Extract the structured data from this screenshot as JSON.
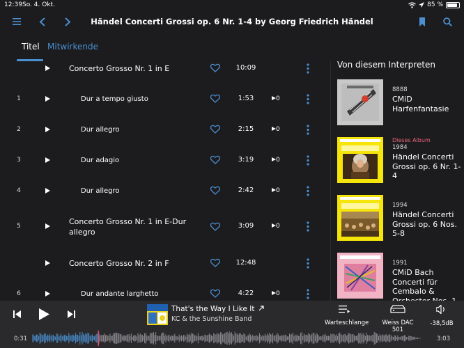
{
  "status": {
    "time": "12:39",
    "date": "So. 4. Okt.",
    "battery": "85 %"
  },
  "nav": {
    "title": "Händel Concerti Grossi op. 6 Nr. 1-4 by Georg Friedrich Händel"
  },
  "tabs": [
    {
      "label": "Titel",
      "active": true
    },
    {
      "label": "Mitwirkende",
      "active": false
    }
  ],
  "tracks": [
    {
      "num": "",
      "name": "Concerto Grosso Nr. 1 in E",
      "duration": "10:09",
      "plays": "",
      "header": true
    },
    {
      "num": "1",
      "name": "Dur a tempo giusto",
      "duration": "1:53",
      "plays": "0",
      "header": false
    },
    {
      "num": "2",
      "name": "Dur allegro",
      "duration": "2:15",
      "plays": "0",
      "header": false
    },
    {
      "num": "3",
      "name": "Dur adagio",
      "duration": "3:19",
      "plays": "0",
      "header": false
    },
    {
      "num": "4",
      "name": "Dur allegro",
      "duration": "2:42",
      "plays": "0",
      "header": false
    },
    {
      "num": "5",
      "name": "Concerto Grosso Nr. 1 in E-Dur",
      "name2": "allegro",
      "duration": "3:09",
      "plays": "0",
      "header": true
    },
    {
      "num": "",
      "name": "Concerto Grosso Nr. 2 in F",
      "duration": "12:48",
      "plays": "",
      "header": true
    },
    {
      "num": "6",
      "name": "Dur andante larghetto",
      "duration": "4:22",
      "plays": "0",
      "header": false
    }
  ],
  "sidebar": {
    "heading": "Von diesem Interpreten",
    "albums": [
      {
        "badge": "",
        "year": "8888",
        "name": "CMiD Harfenfantasie"
      },
      {
        "badge": "Dieses Album",
        "year": "1984",
        "name": "Händel Concerti Grossi op. 6 Nr. 1-4"
      },
      {
        "badge": "",
        "year": "1994",
        "name": "Händel Concerti Grossi op. 6 Nos. 5-8"
      },
      {
        "badge": "",
        "year": "1991",
        "name": "CMiD Bach Concerti für Cembalo & Orchester Nos. 1,"
      }
    ]
  },
  "player": {
    "title": "That's the Way I Like It",
    "artist": "KC & the Sunshine Band",
    "elapsed": "0:31",
    "total": "3:03",
    "progress": 0.17,
    "queue_label": "Warteschlange",
    "device_label": "Weiss DAC 501",
    "volume_label": "-38,5dB"
  },
  "colors": {
    "accent": "#4a8fd0",
    "badge": "#e8657a",
    "background": "#1c1c1e",
    "player_bg": "#2a2a2c"
  }
}
